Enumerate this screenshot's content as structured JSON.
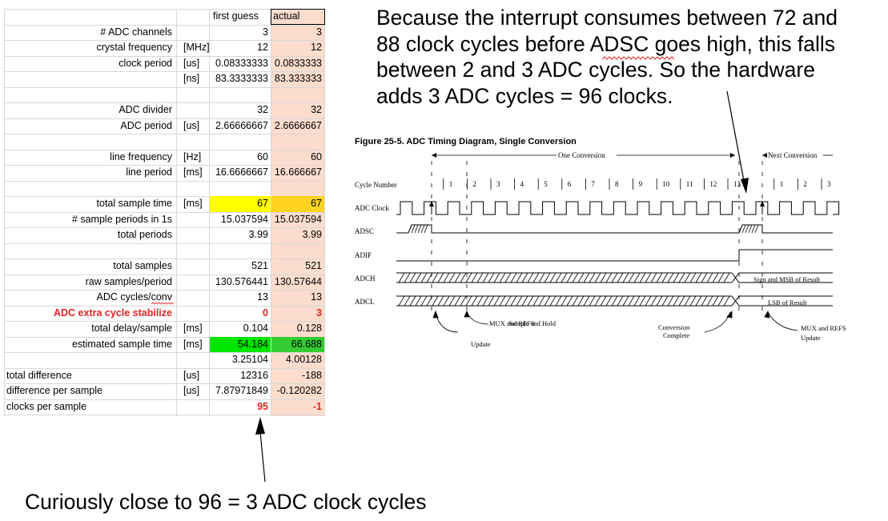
{
  "sheet": {
    "headers": {
      "first": "first guess",
      "actual": "actual"
    },
    "rows": [
      {
        "label": "# ADC channels",
        "unit": "",
        "first": "3",
        "actual": "3"
      },
      {
        "label": "crystal frequency",
        "unit": "[MHz]",
        "first": "12",
        "actual": "12"
      },
      {
        "label": "clock period",
        "unit": "[us]",
        "first": "0.08333333",
        "actual": "0.0833333"
      },
      {
        "label": "",
        "unit": "[ns]",
        "first": "83.3333333",
        "actual": "83.333333"
      },
      {
        "label": "",
        "unit": "",
        "first": "",
        "actual": ""
      },
      {
        "label": "ADC divider",
        "unit": "",
        "first": "32",
        "actual": "32"
      },
      {
        "label": "ADC period",
        "unit": "[us]",
        "first": "2.66666667",
        "actual": "2.6666667"
      },
      {
        "label": "",
        "unit": "",
        "first": "",
        "actual": ""
      },
      {
        "label": "line frequency",
        "unit": "[Hz]",
        "first": "60",
        "actual": "60"
      },
      {
        "label": "line period",
        "unit": "[ms]",
        "first": "16.6666667",
        "actual": "16.666667"
      },
      {
        "label": "",
        "unit": "",
        "first": "",
        "actual": ""
      },
      {
        "label": "total sample time",
        "unit": "[ms]",
        "first": "67",
        "actual": "67"
      },
      {
        "label": "# sample periods in 1s",
        "unit": "",
        "first": "15.037594",
        "actual": "15.037594"
      },
      {
        "label": "total periods",
        "unit": "",
        "first": "3.99",
        "actual": "3.99"
      },
      {
        "label": "",
        "unit": "",
        "first": "",
        "actual": ""
      },
      {
        "label": "total samples",
        "unit": "",
        "first": "521",
        "actual": "521"
      },
      {
        "label": "raw samples/period",
        "unit": "",
        "first": "130.576441",
        "actual": "130.57644"
      },
      {
        "label": "ADC cycles/conv",
        "unit": "",
        "first": "13",
        "actual": "13"
      },
      {
        "label": "ADC extra cycle stabilize",
        "unit": "",
        "first": "0",
        "actual": "3"
      },
      {
        "label": "total delay/sample",
        "unit": "[ms]",
        "first": "0.104",
        "actual": "0.128"
      },
      {
        "label": "estimated sample time",
        "unit": "[ms]",
        "first": "54.184",
        "actual": "66.688"
      },
      {
        "label": "",
        "unit": "",
        "first": "3.25104",
        "actual": "4.00128"
      },
      {
        "label": "total difference",
        "unit": "[us]",
        "first": "12316",
        "actual": "-188"
      },
      {
        "label": "difference per sample",
        "unit": "[us]",
        "first": "7.87971849",
        "actual": "-0.120282"
      },
      {
        "label": "clocks per sample",
        "unit": "",
        "first": "95",
        "actual": "-1"
      }
    ],
    "colors": {
      "actual_bg": "#fcdccd",
      "yellow": "#ffff00",
      "orange_yellow": "#ffd320",
      "green_bright": "#00e600",
      "green": "#33cc33",
      "red": "#e02424"
    }
  },
  "note_top": {
    "lines": [
      "Because the interrupt consumes between 72 and",
      "88 clock cycles before ADSC goes high, this falls",
      "between 2 and 3 ADC cycles. So the hardware",
      "adds 3 ADC cycles = 96 clocks."
    ]
  },
  "note_bottom": "Curiously close to 96 = 3 ADC clock cycles",
  "diagram": {
    "title": "Figure 25-5.  ADC Timing Diagram, Single Conversion",
    "one_conversion": "One Conversion",
    "next_conversion": "Next Conversion",
    "signals": [
      "Cycle Number",
      "ADC Clock",
      "ADSC",
      "ADIF",
      "ADCH",
      "ADCL"
    ],
    "cycle_numbers": [
      "1",
      "2",
      "3",
      "4",
      "5",
      "6",
      "7",
      "8",
      "9",
      "10",
      "11",
      "12",
      "13"
    ],
    "next_cycle_numbers": [
      "1",
      "2",
      "3"
    ],
    "adch_label": "Sign and MSB of Result",
    "adcl_label": "LSB of Result",
    "annotations": {
      "mux1": "MUX and REFS",
      "update1": "Update",
      "sample_hold": "Sample and Hold",
      "conv": "Conversion",
      "complete": "Complete",
      "mux2": "MUX and REFS",
      "update2": "Update"
    }
  }
}
